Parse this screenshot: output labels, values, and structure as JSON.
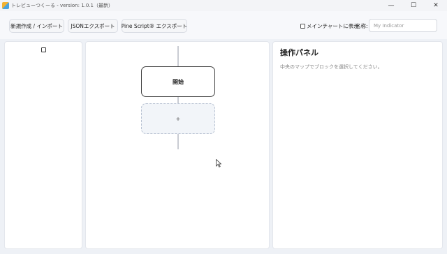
{
  "window": {
    "title": "トレビューつくーる - version: 1.0.1（最新）",
    "controls": {
      "minimize": "—",
      "maximize": "☐",
      "close": "✕"
    }
  },
  "toolbar": {
    "new_import_label": "新規作成 / インポート",
    "json_export_label": "JSONエクスポート",
    "pine_export_label": "Pine Script® エクスポート",
    "main_chart_label": "メインチャートに表示",
    "main_chart_checked": false,
    "name_label": "名称:",
    "name_placeholder": "My Indicator",
    "name_value": ""
  },
  "flow": {
    "start_label": "開始",
    "add_label": "+"
  },
  "ops_panel": {
    "title": "操作パネル",
    "description": "中央のマップでブロックを選択してください。"
  }
}
